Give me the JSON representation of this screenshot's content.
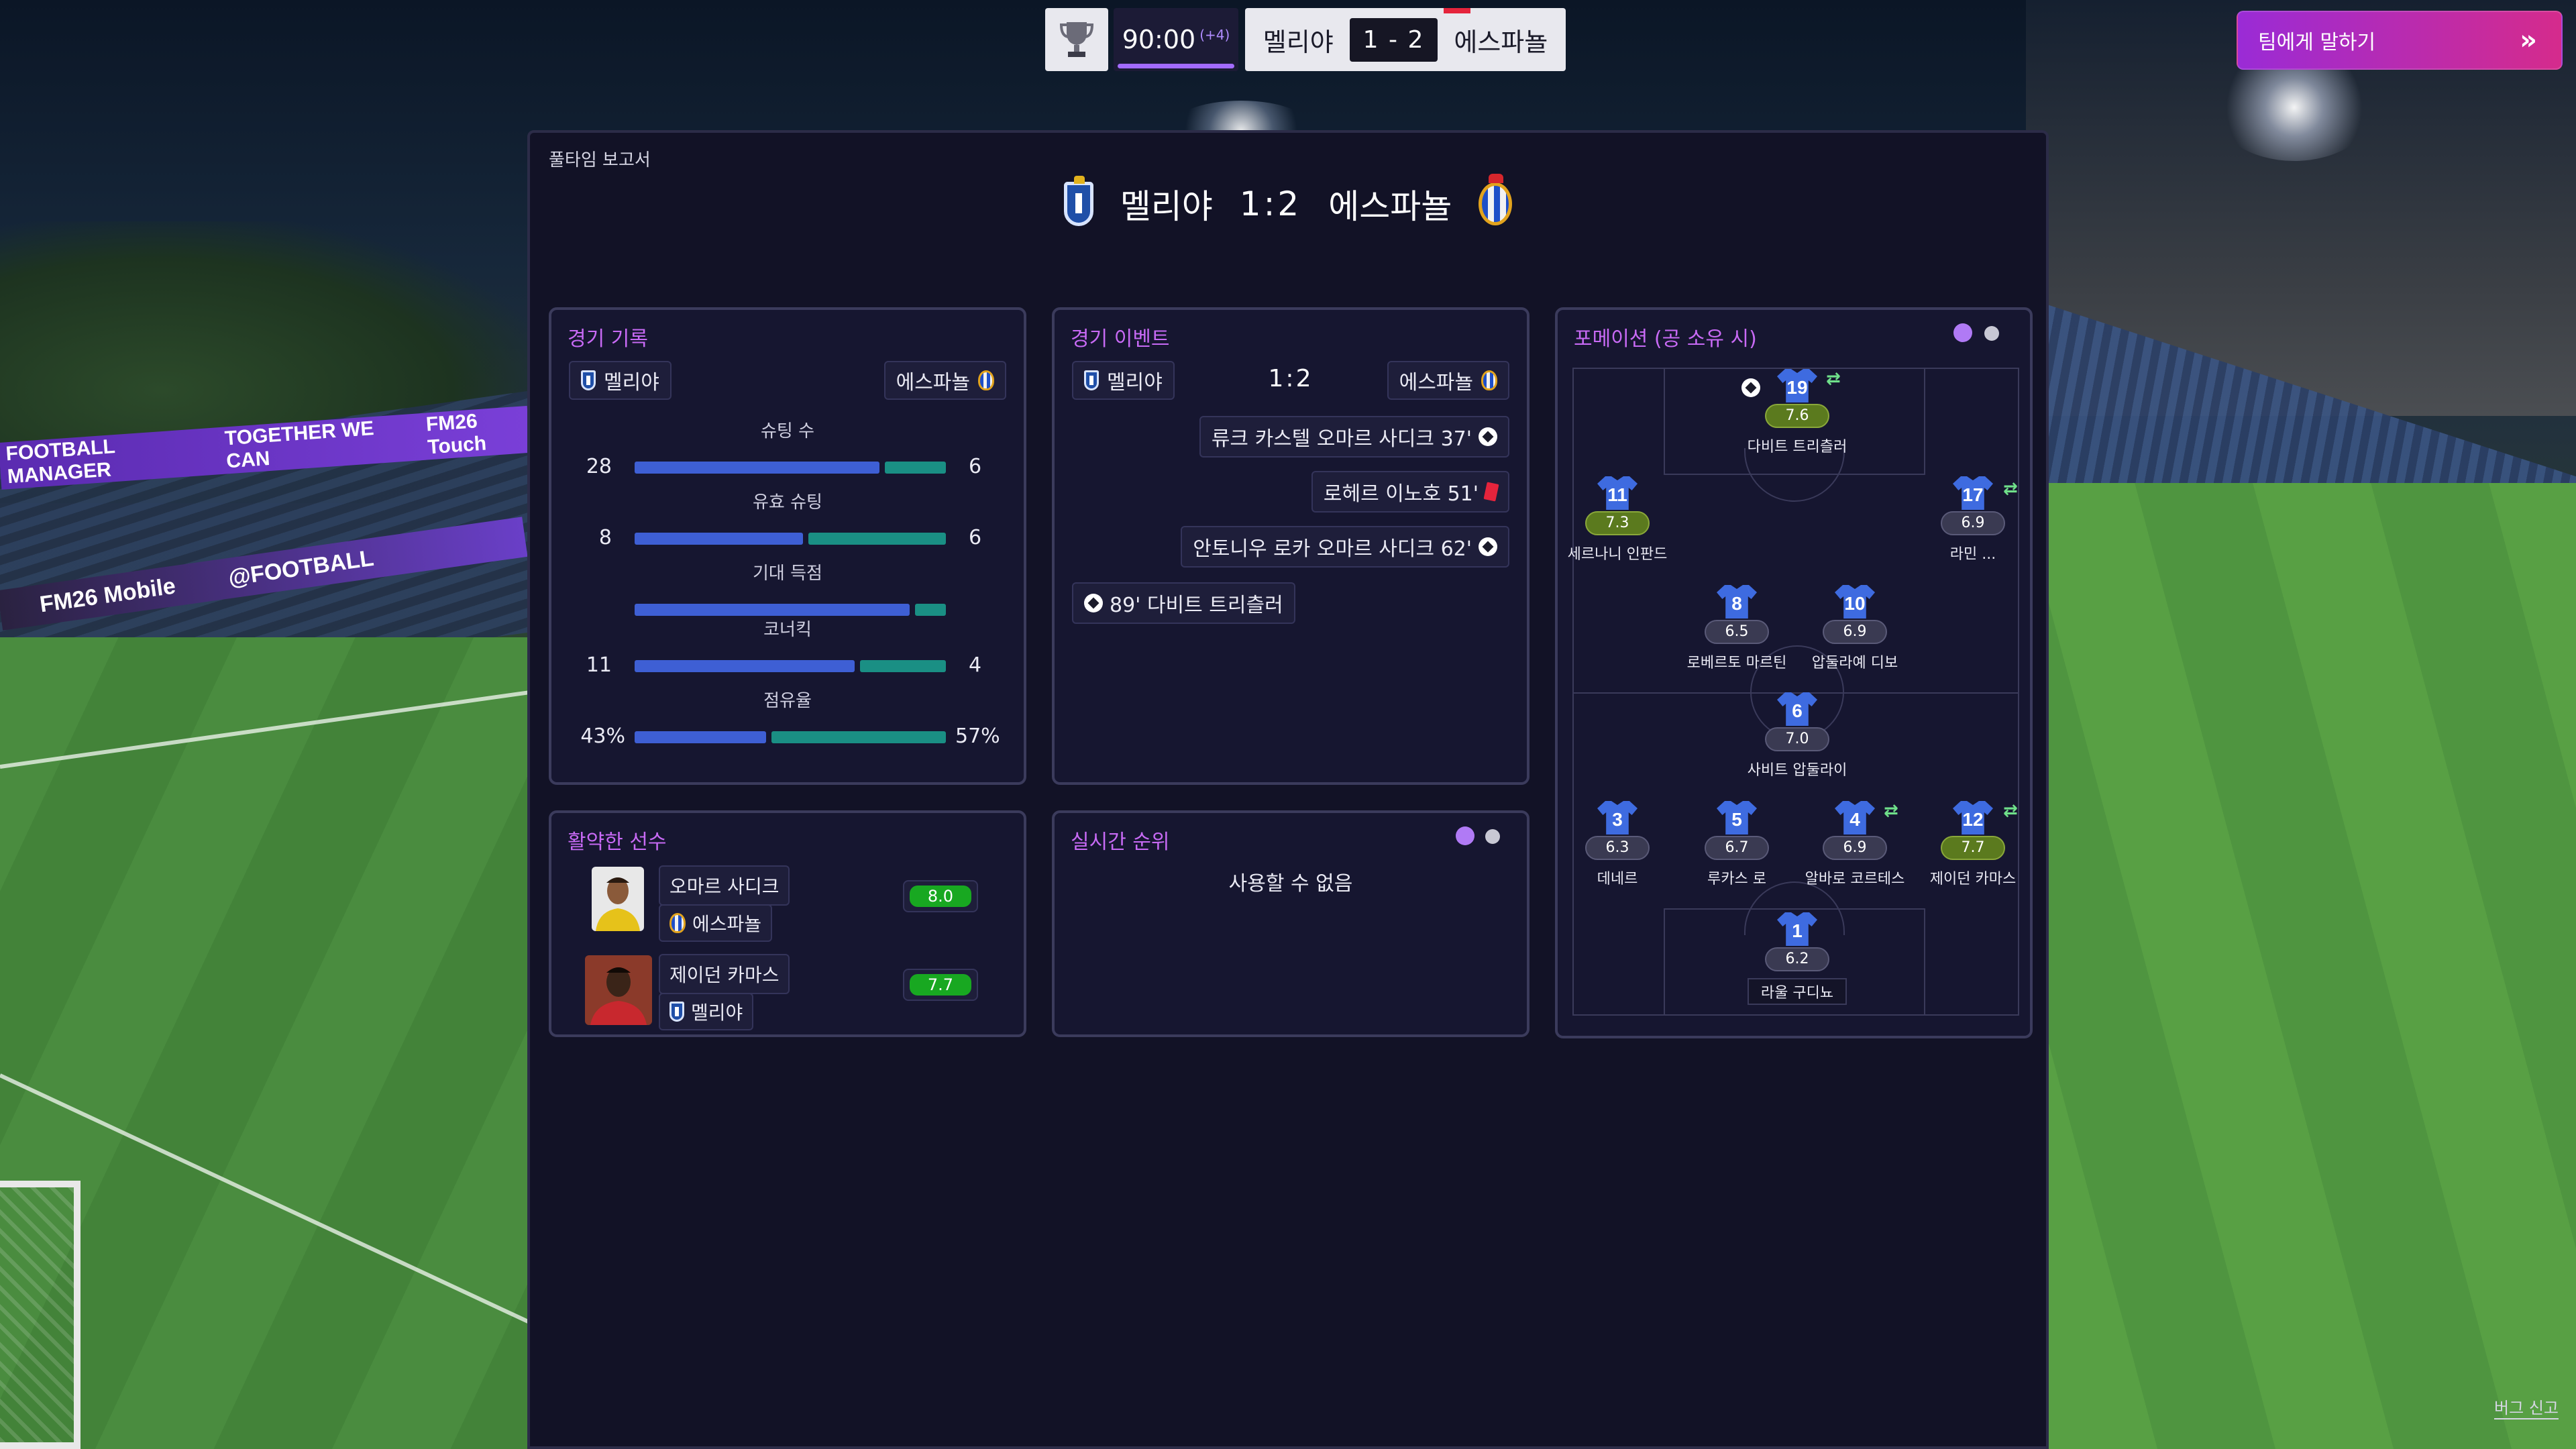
{
  "topbar": {
    "time": "90:00",
    "added_time": "(+4)",
    "home": "멜리야",
    "away": "에스파뇰",
    "score": "1 - 2"
  },
  "talk_button": {
    "label": "팀에게 말하기"
  },
  "panel": {
    "title": "풀타임 보고서",
    "home": "멜리야",
    "away": "에스파뇰",
    "score": "1:2"
  },
  "stats_card": {
    "title": "경기 기록",
    "home": "멜리야",
    "away": "에스파뇰",
    "stats": [
      {
        "label": "슈팅 수",
        "home": "28",
        "away": "6",
        "home_share": 0.8
      },
      {
        "label": "유효 슈팅",
        "home": "8",
        "away": "6",
        "home_share": 0.55
      },
      {
        "label": "기대 득점",
        "home": "",
        "away": "",
        "home_share": 0.9
      },
      {
        "label": "코너킥",
        "home": "11",
        "away": "4",
        "home_share": 0.72
      },
      {
        "label": "점유율",
        "home": "43%",
        "away": "57%",
        "home_share": 0.43
      }
    ]
  },
  "events_card": {
    "title": "경기 이벤트",
    "home": "멜리야",
    "away": "에스파뇰",
    "score": "1:2",
    "events": [
      {
        "text": "류크 카스텔 오마르 사디크 37'",
        "icon": "ball-icon",
        "side": "away"
      },
      {
        "text": "로헤르 이노호 51'",
        "icon": "red-card-icon",
        "side": "away"
      },
      {
        "text": "안토니우 로카 오마르 사디크 62'",
        "icon": "ball-icon",
        "side": "away"
      },
      {
        "text": "89' 다비트 트리츨러",
        "icon": "ball-icon",
        "side": "home"
      }
    ]
  },
  "players_card": {
    "title": "활약한 선수",
    "players": [
      {
        "name": "오마르 사디크",
        "team": "에스파뇰",
        "rating": "8.0"
      },
      {
        "name": "제이던 카마스",
        "team": "멜리야",
        "rating": "7.7"
      }
    ]
  },
  "live_table_card": {
    "title": "실시간 순위",
    "message": "사용할 수 없음"
  },
  "formation_card": {
    "title": "포메이션 (공 소유 시)",
    "players": [
      {
        "num": "19",
        "rating": "7.6",
        "name": "다비트 트리츨러"
      },
      {
        "num": "11",
        "rating": "7.3",
        "name": "세르나니 인판드"
      },
      {
        "num": "17",
        "rating": "6.9",
        "name": "라민 ..."
      },
      {
        "num": "8",
        "rating": "6.5",
        "name": "로베르토 마르틴"
      },
      {
        "num": "10",
        "rating": "6.9",
        "name": "압둘라예 디보"
      },
      {
        "num": "6",
        "rating": "7.0",
        "name": "사비트 압둘라이"
      },
      {
        "num": "3",
        "rating": "6.3",
        "name": "데네르"
      },
      {
        "num": "5",
        "rating": "6.7",
        "name": "루카스 로"
      },
      {
        "num": "4",
        "rating": "6.9",
        "name": "알바로 코르테스"
      },
      {
        "num": "12",
        "rating": "7.7",
        "name": "제이던 카마스"
      },
      {
        "num": "1",
        "rating": "6.2",
        "name": "라울 구디뇨"
      }
    ]
  },
  "background": {
    "banner_texts": [
      "FOOTBALL MANAGER",
      "TOGETHER WE CAN",
      "FM26 Touch"
    ],
    "banner2_texts": [
      "FM26 Mobile",
      "@FOOTBALL"
    ]
  },
  "footer": {
    "bug_report": "버그 신고"
  },
  "colors": {
    "accent": "#c86af5",
    "home_bar": "#3e5fd4",
    "away_bar": "#1a8f84",
    "rating_good": "#18a821",
    "talk_gradient_start": "#9a2bd6",
    "talk_gradient_end": "#d52b8c"
  }
}
